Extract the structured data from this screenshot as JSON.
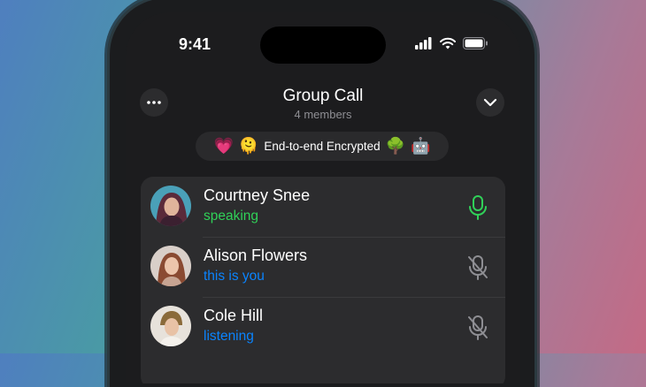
{
  "status_bar": {
    "time": "9:41"
  },
  "header": {
    "title": "Group Call",
    "subtitle": "4 members"
  },
  "encryption": {
    "emoji_left": [
      "💗",
      "🫠"
    ],
    "label": "End-to-end Encrypted",
    "emoji_right": [
      "🌳",
      "🤖"
    ]
  },
  "participants": [
    {
      "name": "Courtney Snee",
      "status": "speaking",
      "status_color": "#30d158",
      "mic": "active"
    },
    {
      "name": "Alison Flowers",
      "status": "this is you",
      "status_color": "#0a84ff",
      "mic": "muted"
    },
    {
      "name": "Cole Hill",
      "status": "listening",
      "status_color": "#0a84ff",
      "mic": "muted"
    }
  ],
  "colors": {
    "green": "#30d158",
    "blue": "#0a84ff",
    "muted_icon": "#8e8e93"
  }
}
